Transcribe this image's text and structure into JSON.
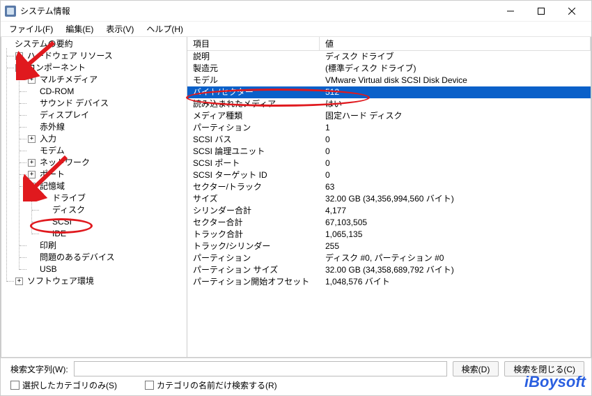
{
  "window": {
    "title": "システム情報"
  },
  "menubar": {
    "file": "ファイル(F)",
    "edit": "編集(E)",
    "view": "表示(V)",
    "help": "ヘルプ(H)"
  },
  "tree": {
    "root": {
      "label": "システムの要約",
      "expand": "-"
    },
    "hw": {
      "label": "ハードウェア リソース",
      "expand": "+"
    },
    "components": {
      "label": "コンポーネント",
      "expand": "-",
      "multimedia": {
        "label": "マルチメディア",
        "expand": "+"
      },
      "cdrom": "CD-ROM",
      "sound": "サウンド デバイス",
      "display": "ディスプレイ",
      "infrared": "赤外線",
      "input": {
        "label": "入力",
        "expand": "+"
      },
      "modem": "モデム",
      "network": {
        "label": "ネットワーク",
        "expand": "+"
      },
      "ports": {
        "label": "ポート",
        "expand": "+"
      },
      "storage": {
        "label": "記憶域",
        "expand": "-",
        "drives": "ドライブ",
        "disks": "ディスク",
        "scsi": "SCSI",
        "ide": "IDE"
      },
      "printing": "印刷",
      "problem": "問題のあるデバイス",
      "usb": "USB"
    },
    "softenv": {
      "label": "ソフトウェア環境",
      "expand": "+"
    }
  },
  "detail_header": {
    "item": "項目",
    "value": "値"
  },
  "details": [
    {
      "item": "説明",
      "value": "ディスク ドライブ"
    },
    {
      "item": "製造元",
      "value": "(標準ディスク ドライブ)"
    },
    {
      "item": "モデル",
      "value": "VMware Virtual disk SCSI Disk Device"
    },
    {
      "item": "バイト/セクター",
      "value": "512",
      "selected": true
    },
    {
      "item": "読み込まれたメディア",
      "value": "はい"
    },
    {
      "item": "メディア種類",
      "value": "固定ハード ディスク"
    },
    {
      "item": "パーティション",
      "value": "1"
    },
    {
      "item": "SCSI バス",
      "value": "0"
    },
    {
      "item": "SCSI 論理ユニット",
      "value": "0"
    },
    {
      "item": "SCSI ポート",
      "value": "0"
    },
    {
      "item": "SCSI ターゲット ID",
      "value": "0"
    },
    {
      "item": "セクター/トラック",
      "value": "63"
    },
    {
      "item": "サイズ",
      "value": "32.00 GB (34,356,994,560 バイト)"
    },
    {
      "item": "シリンダー合計",
      "value": "4,177"
    },
    {
      "item": "セクター合計",
      "value": "67,103,505"
    },
    {
      "item": "トラック合計",
      "value": "1,065,135"
    },
    {
      "item": "トラック/シリンダー",
      "value": "255"
    },
    {
      "item": "パーティション",
      "value": "ディスク #0, パーティション #0"
    },
    {
      "item": "パーティション サイズ",
      "value": "32.00 GB (34,358,689,792 バイト)"
    },
    {
      "item": "パーティション開始オフセット",
      "value": "1,048,576 バイト"
    }
  ],
  "bottom": {
    "search_label": "検索文字列(W):",
    "search_btn": "検索(D)",
    "close_search_btn": "検索を閉じる(C)",
    "chk_selected": "選択したカテゴリのみ(S)",
    "chk_nameonly": "カテゴリの名前だけ検索する(R)"
  },
  "watermark": "iBoysoft"
}
